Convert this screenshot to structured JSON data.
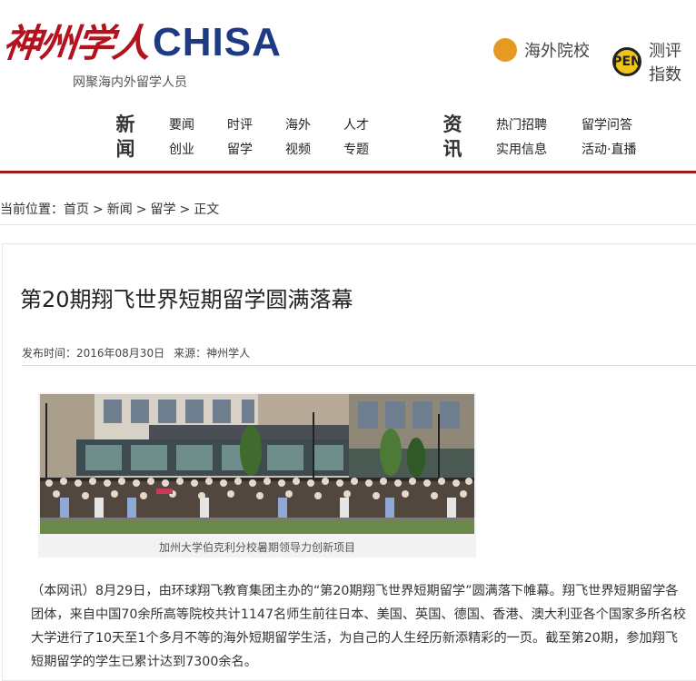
{
  "brand": {
    "logo_cn": "神州学人",
    "logo_en": "CHISA",
    "tagline": "网聚海内外留学人员",
    "colors": {
      "red": "#b3121f",
      "blue": "#1d3a82",
      "rule": "#9b1b1f"
    }
  },
  "top_links": [
    {
      "label": "海外院校",
      "icon": "schools-icon"
    },
    {
      "label": "测评指数",
      "icon": "evaluation-icon"
    }
  ],
  "nav": {
    "news": {
      "category": [
        "新",
        "闻"
      ],
      "row1": [
        "要闻",
        "时评",
        "海外",
        "人才"
      ],
      "row2": [
        "创业",
        "留学",
        "视频",
        "专题"
      ]
    },
    "info": {
      "category": [
        "资",
        "讯"
      ],
      "row1": [
        "热门招聘",
        "留学问答"
      ],
      "row2": [
        "实用信息",
        "活动·直播"
      ]
    }
  },
  "breadcrumb": {
    "prefix": "当前位置：",
    "items": [
      "首页",
      "新闻",
      "留学",
      "正文"
    ],
    "separator": ">"
  },
  "article": {
    "title": "第20期翔飞世界短期留学圆满落幕",
    "date": "发布时间：2016年08月30日",
    "source": "来源：神州学人",
    "image_caption": "加州大学伯克利分校暑期领导力创新项目",
    "paragraph": "（本网讯）8月29日，由环球翔飞教育集团主办的“第20期翔飞世界短期留学”圆满落下帷幕。翔飞世界短期留学各团体，来自中国70余所高等院校共计1147名师生前往日本、美国、英国、德国、香港、澳大利亚各个国家多所名校大学进行了10天至1个多月不等的海外短期留学生活，为自己的人生经历新添精彩的一页。截至第20期，参加翔飞短期留学的学生已累计达到7300余名。"
  }
}
